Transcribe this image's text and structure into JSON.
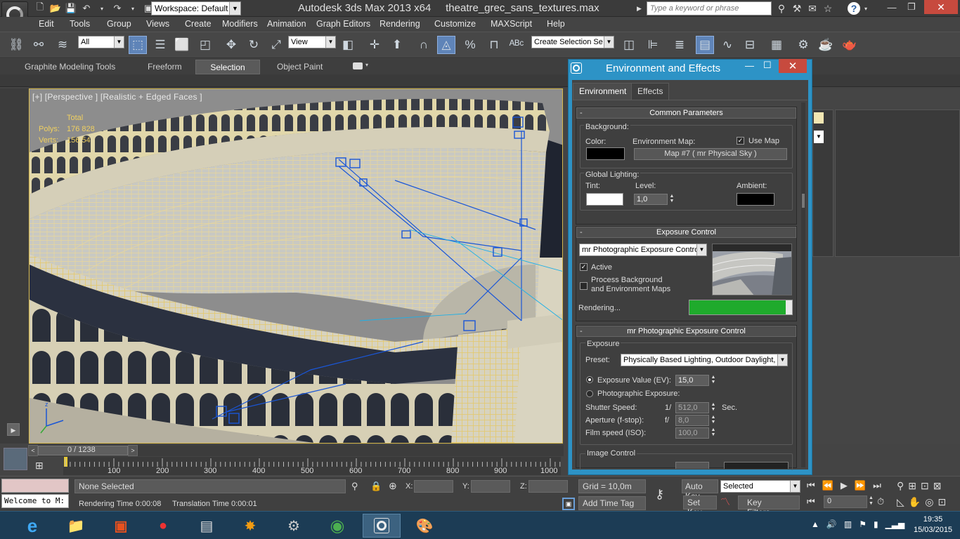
{
  "titlebar": {
    "workspace_label": "Workspace: Default",
    "app_name": "Autodesk 3ds Max  2013 x64",
    "file_name": "theatre_grec_sans_textures.max",
    "search_placeholder": "Type a keyword or phrase"
  },
  "menu": [
    "Edit",
    "Tools",
    "Group",
    "Views",
    "Create",
    "Modifiers",
    "Animation",
    "Graph Editors",
    "Rendering",
    "Customize",
    "MAXScript",
    "Help"
  ],
  "toolbar": {
    "selection_filter": "All",
    "ref_coord": "View",
    "named_selection": "Create Selection Se"
  },
  "ribbon": {
    "tabs": [
      "Graphite Modeling Tools",
      "Freeform",
      "Selection",
      "Object Paint"
    ]
  },
  "viewport": {
    "label": "[+] [Perspective ] [Realistic + Edged Faces ]",
    "stats_header": "Total",
    "polys_label": "Polys:",
    "polys_value": "176 828",
    "verts_label": "Verts:",
    "verts_value": "156 54"
  },
  "timeline": {
    "frame_label": "0 / 1238",
    "ticks": [
      "100",
      "200",
      "300",
      "400",
      "500",
      "600",
      "700",
      "800",
      "900",
      "1000"
    ]
  },
  "status": {
    "listener": "Welcome to M:",
    "selection": "None Selected",
    "rendering_time": "Rendering Time  0:00:08",
    "translation_time": "Translation Time  0:00:01",
    "x_label": "X:",
    "y_label": "Y:",
    "z_label": "Z:",
    "grid": "Grid = 10,0m",
    "add_time_tag": "Add Time Tag",
    "auto_key": "Auto Key",
    "set_key": "Set Key",
    "key_mode": "Selected",
    "key_filters": "Key Filters...",
    "frame_value": "0"
  },
  "dialog": {
    "title": "Environment and Effects",
    "tabs": [
      "Environment",
      "Effects"
    ],
    "common": {
      "header": "Common Parameters",
      "background_label": "Background:",
      "color_label": "Color:",
      "env_map_label": "Environment Map:",
      "use_map_label": "Use Map",
      "map_button": "Map #7  ( mr Physical Sky )",
      "global_lighting_label": "Global Lighting:",
      "tint_label": "Tint:",
      "level_label": "Level:",
      "level_value": "1,0",
      "ambient_label": "Ambient:"
    },
    "exposure": {
      "header": "Exposure Control",
      "control_value": "mr Photographic Exposure Control",
      "active_label": "Active",
      "process_bg_label_1": "Process Background",
      "process_bg_label_2": "and Environment Maps",
      "rendering_label": "Rendering...",
      "render_progress": 0.94
    },
    "mr_exposure": {
      "header": "mr Photographic Exposure Control",
      "exposure_group": "Exposure",
      "preset_label": "Preset:",
      "preset_value": "Physically Based Lighting, Outdoor Daylight, Clear Sky",
      "ev_label": "Exposure Value (EV):",
      "ev_value": "15,0",
      "photo_exposure_label": "Photographic Exposure:",
      "shutter_label": "Shutter Speed:",
      "shutter_prefix": "1/",
      "shutter_value": "512,0",
      "shutter_unit": "Sec.",
      "aperture_label": "Aperture (f-stop):",
      "aperture_prefix": "f/",
      "aperture_value": "8,0",
      "iso_label": "Film speed (ISO):",
      "iso_value": "100,0",
      "image_control_label": "Image Control"
    }
  },
  "taskbar": {
    "time": "19:35",
    "date": "15/03/2015"
  },
  "colors": {
    "dialog_frame": "#2d93c6",
    "close_red": "#c74a3e",
    "progress_green": "#1faa2c",
    "viewport_border": "#d6b84a"
  }
}
